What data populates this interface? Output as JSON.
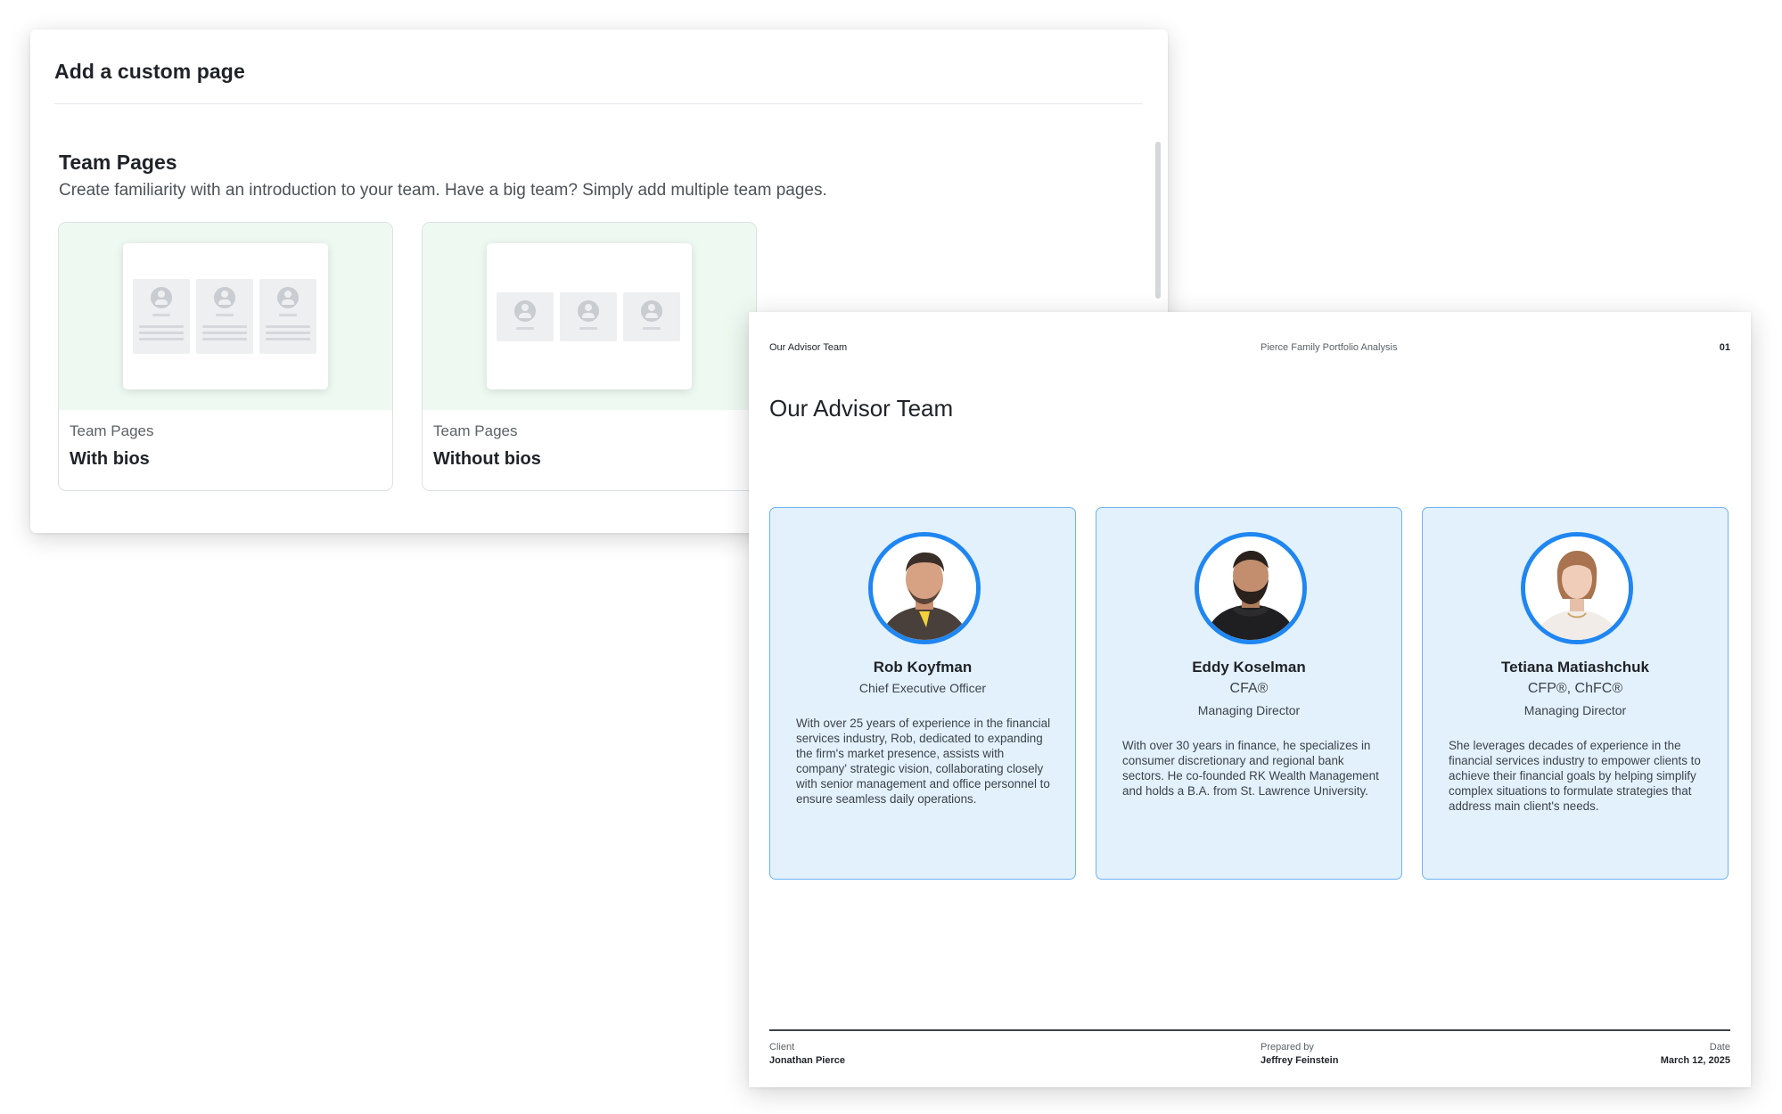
{
  "dialog": {
    "title": "Add a custom page",
    "section_title": "Team Pages",
    "section_description": "Create familiarity with an introduction to your team. Have a big team? Simply add multiple team pages.",
    "templates": [
      {
        "category": "Team Pages",
        "name": "With bios"
      },
      {
        "category": "Team Pages",
        "name": "Without bios"
      }
    ]
  },
  "report": {
    "header_left": "Our Advisor Team",
    "header_center": "Pierce Family Portfolio Analysis",
    "page_number": "01",
    "title": "Our Advisor Team",
    "members": [
      {
        "name": "Rob Koyfman",
        "credentials": "",
        "role": "Chief Executive Officer",
        "bio": "With over 25 years of experience in the financial services industry, Rob, dedicated to expanding the firm's market presence, assists with company' strategic vision, collaborating closely with senior management and office personnel to ensure seamless daily operations."
      },
      {
        "name": "Eddy Koselman",
        "credentials": "CFA®",
        "role": "Managing Director",
        "bio": "With over 30 years in finance, he specializes in consumer discretionary and regional bank sectors. He co-founded RK Wealth Management and holds a B.A. from St. Lawrence University."
      },
      {
        "name": "Tetiana Matiashchuk",
        "credentials": "CFP®, ChFC®",
        "role": "Managing Director",
        "bio": "She leverages decades of experience in the financial services industry to empower clients to achieve their financial goals by helping simplify complex situations to formulate strategies that address main client's needs."
      }
    ],
    "footer": {
      "client_label": "Client",
      "client_value": "Jonathan Pierce",
      "prepared_label": "Prepared by",
      "prepared_value": "Jeffrey Feinstein",
      "date_label": "Date",
      "date_value": "March 12, 2025"
    }
  },
  "colors": {
    "accent_blue": "#1f86f2",
    "card_blue_bg": "#e3f1fd",
    "template_preview_bg": "#eef9f2"
  },
  "icons": [
    "person-placeholder-icon"
  ]
}
